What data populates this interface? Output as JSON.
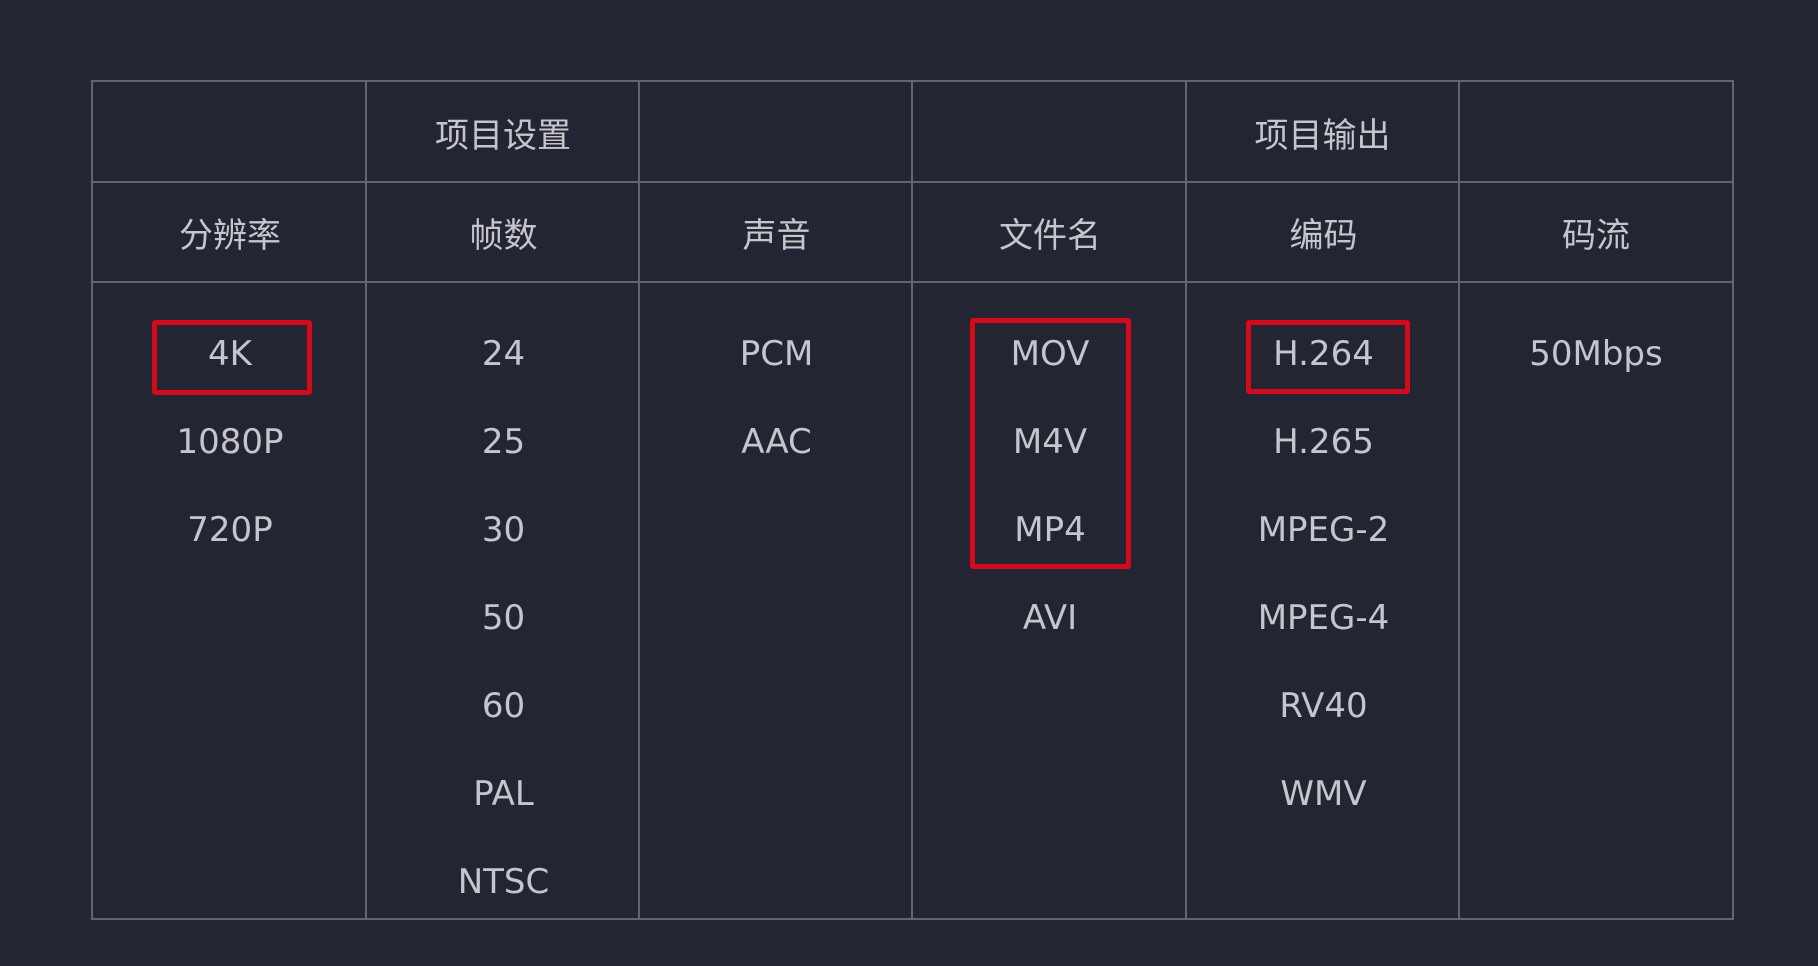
{
  "groups": [
    {
      "label": "项目设置"
    },
    {
      "label": "项目输出"
    }
  ],
  "columns": [
    {
      "header": "分辨率",
      "items": [
        "4K",
        "1080P",
        "720P"
      ]
    },
    {
      "header": "帧数",
      "items": [
        "24",
        "25",
        "30",
        "50",
        "60",
        "PAL",
        "NTSC"
      ]
    },
    {
      "header": "声音",
      "items": [
        "PCM",
        "AAC"
      ]
    },
    {
      "header": "文件名",
      "items": [
        "MOV",
        "M4V",
        "MP4",
        "AVI"
      ]
    },
    {
      "header": "编码",
      "items": [
        "H.264",
        "H.265",
        "MPEG-2",
        "MPEG-4",
        "RV40",
        "WMV"
      ]
    },
    {
      "header": "码流",
      "items": [
        "50Mbps"
      ]
    }
  ],
  "highlights": [
    {
      "column": 0,
      "items": [
        "4K"
      ]
    },
    {
      "column": 3,
      "items": [
        "MOV",
        "M4V",
        "MP4"
      ]
    },
    {
      "column": 4,
      "items": [
        "H.264"
      ]
    }
  ],
  "colors": {
    "background": "#232632",
    "grid": "#62656f",
    "text": "#c4c6cb",
    "highlight": "#d40a1b"
  }
}
